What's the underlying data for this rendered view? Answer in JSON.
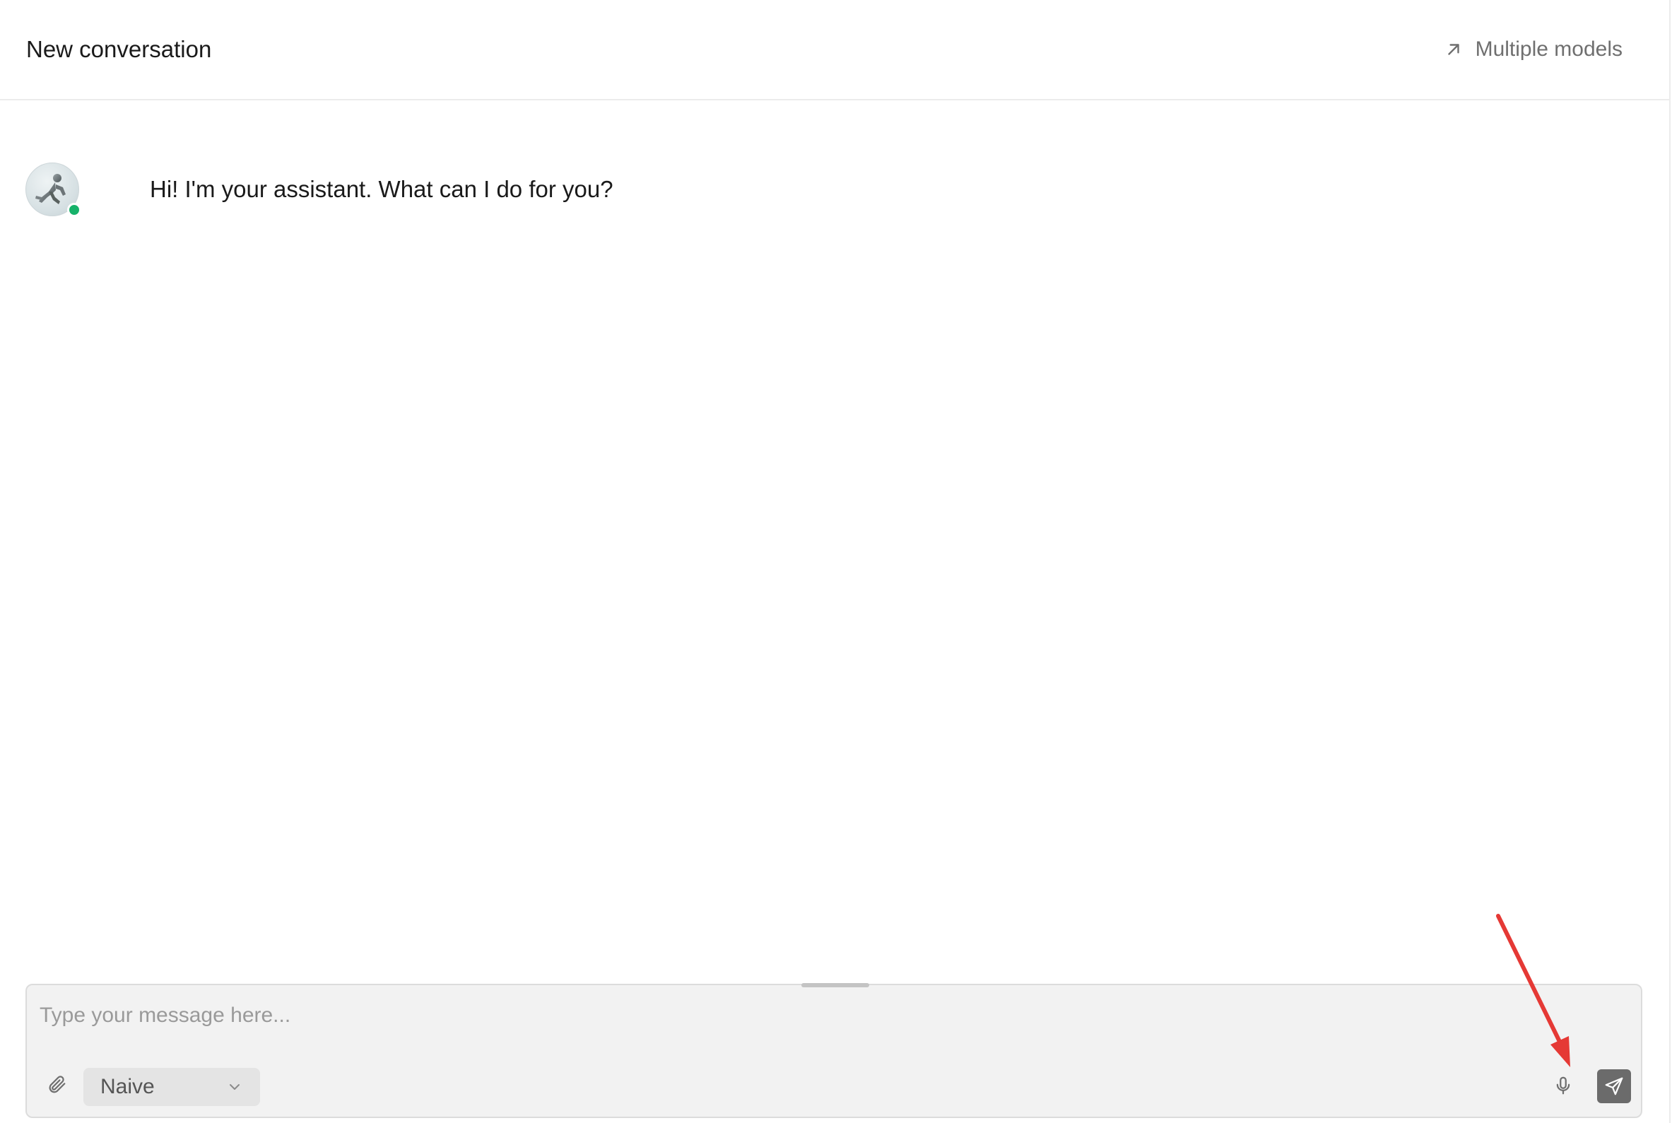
{
  "header": {
    "title": "New conversation",
    "multiple_models_label": "Multiple models",
    "multiple_models_icon": "arrow-up-right-icon"
  },
  "messages": [
    {
      "role": "assistant",
      "avatar": "assistant-avatar",
      "status": "online",
      "status_color": "#17b26a",
      "text": "Hi! I'm your assistant. What can I do for you?"
    }
  ],
  "composer": {
    "placeholder": "Type your message here...",
    "value": "",
    "attach_icon": "paperclip-icon",
    "mode_selected": "Naive",
    "mode_icon": "chevron-down-icon",
    "mic_icon": "microphone-icon",
    "send_icon": "send-icon",
    "send_button_color": "#6b6b6b"
  },
  "annotation": {
    "type": "arrow",
    "color": "#e53935",
    "points_to": "microphone-icon"
  }
}
